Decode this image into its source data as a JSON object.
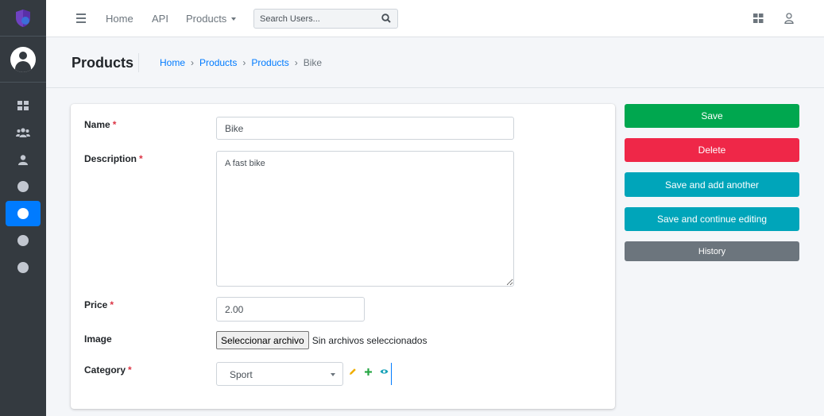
{
  "colors": {
    "sidebar_bg": "#343a40",
    "accent": "#007bff",
    "success": "#00a74f",
    "danger": "#ef2748",
    "info": "#00a5ba",
    "secondary": "#6c757d"
  },
  "sidebar": {
    "logo_icon": "shield-logo-icon",
    "user_icon": "user-avatar-icon",
    "items": [
      {
        "icon": "dashboard-icon"
      },
      {
        "icon": "users-group-icon"
      },
      {
        "icon": "user-icon"
      },
      {
        "icon": "circle-icon"
      },
      {
        "icon": "circle-icon",
        "active": true
      },
      {
        "icon": "circle-icon"
      },
      {
        "icon": "circle-icon"
      }
    ]
  },
  "navbar": {
    "links": [
      "Home",
      "API",
      "Products"
    ],
    "search_placeholder": "Search Users...",
    "right_icons": [
      "apps-grid-icon",
      "user-outline-icon"
    ]
  },
  "header": {
    "title": "Products",
    "breadcrumb": [
      "Home",
      "Products",
      "Products",
      "Bike"
    ]
  },
  "form": {
    "name_label": "Name",
    "name_value": "Bike",
    "description_label": "Description",
    "description_value": "A fast bike",
    "price_label": "Price",
    "price_value": "2.00",
    "image_label": "Image",
    "file_button": "Seleccionar archivo",
    "file_status": "Sin archivos seleccionados",
    "category_label": "Category",
    "category_value": "Sport",
    "required_mark": "*"
  },
  "actions": {
    "save": "Save",
    "delete": "Delete",
    "save_add": "Save and add another",
    "save_continue": "Save and continue editing",
    "history": "History"
  }
}
